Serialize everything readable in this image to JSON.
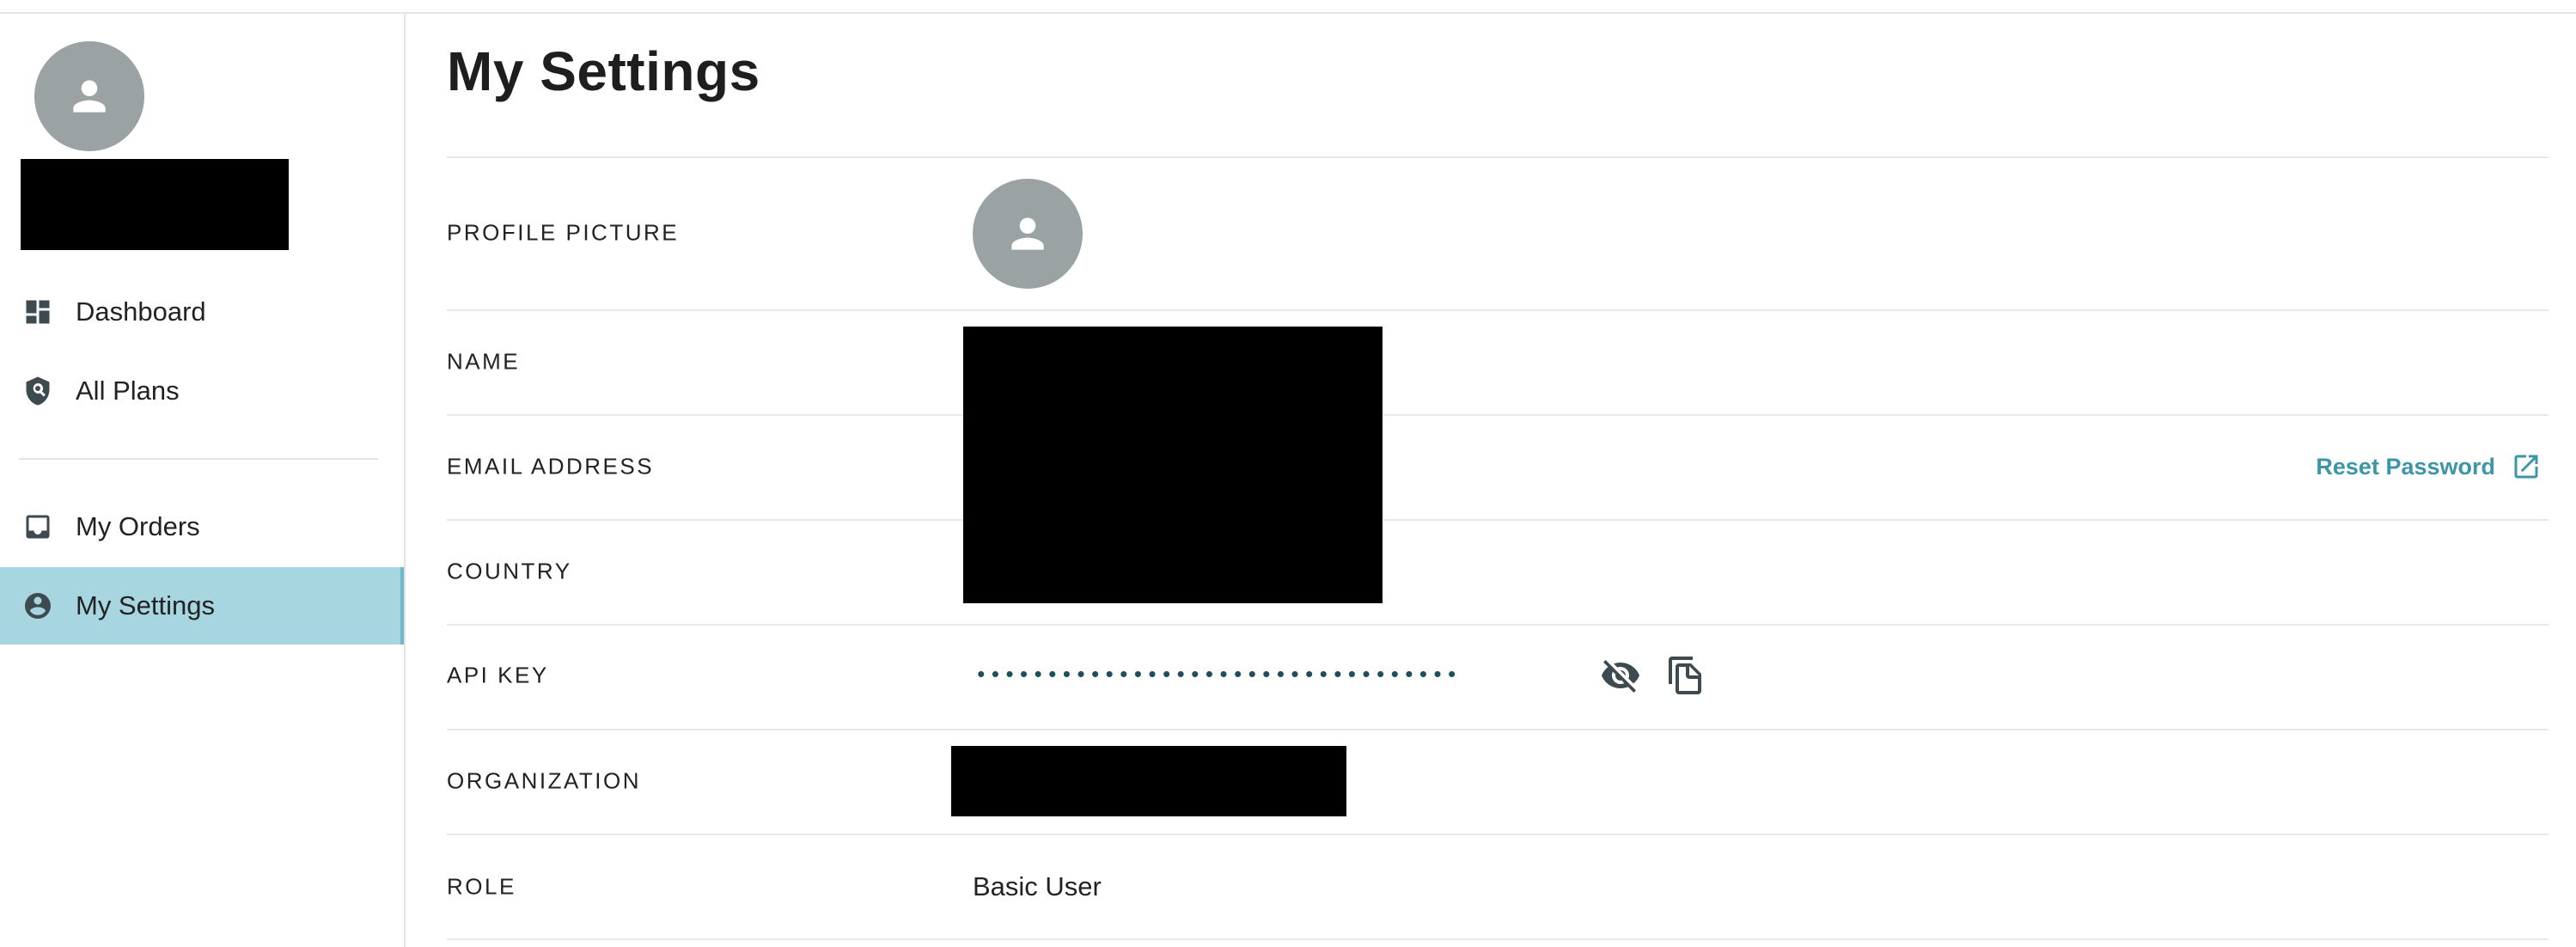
{
  "sidebar": {
    "items": [
      {
        "label": "Dashboard",
        "icon": "dashboard-icon"
      },
      {
        "label": "All Plans",
        "icon": "shield-search-icon"
      },
      {
        "label": "My Orders",
        "icon": "inbox-icon"
      },
      {
        "label": "My Settings",
        "icon": "account-circle-icon",
        "active": true
      }
    ]
  },
  "main": {
    "title": "My Settings",
    "fields": {
      "profile_picture": "PROFILE PICTURE",
      "name": "NAME",
      "email": "EMAIL ADDRESS",
      "country": "COUNTRY",
      "api_key": "API KEY",
      "organization": "ORGANIZATION",
      "role": "ROLE"
    },
    "reset_password": "Reset Password",
    "api_key_masked": "••••••••••••••••••••••••••••••••••",
    "role_value": "Basic User"
  },
  "colors": {
    "active_nav_bg": "#a8d6e0",
    "link": "#3c96a8",
    "avatar": "#9aa2a4"
  }
}
